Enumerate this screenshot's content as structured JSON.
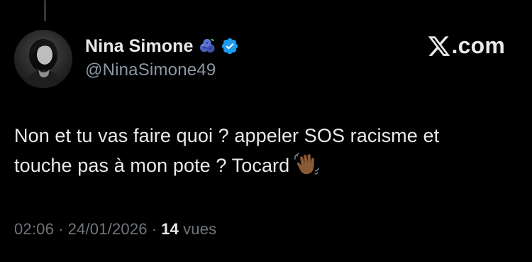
{
  "author": {
    "display_name": "Nina Simone",
    "handle": "@NinaSimone49",
    "verified": true,
    "name_emoji": "blueberries-icon"
  },
  "brand": {
    "text": ".com",
    "logo": "x-logo-icon"
  },
  "tweet": {
    "line1": "Non et tu vas faire quoi ? appeler SOS racisme et",
    "line2": "touche pas à mon pote ? Tocard",
    "trailing_emoji": "waving-hand-icon"
  },
  "meta": {
    "time": "02:06",
    "separator": "·",
    "date": "24/01/2026",
    "views_count": "14",
    "views_label": "vues"
  },
  "colors": {
    "background": "#000000",
    "primary_text": "#e7e9ea",
    "secondary_text": "#71767b",
    "verified_blue": "#1d9bf0"
  }
}
